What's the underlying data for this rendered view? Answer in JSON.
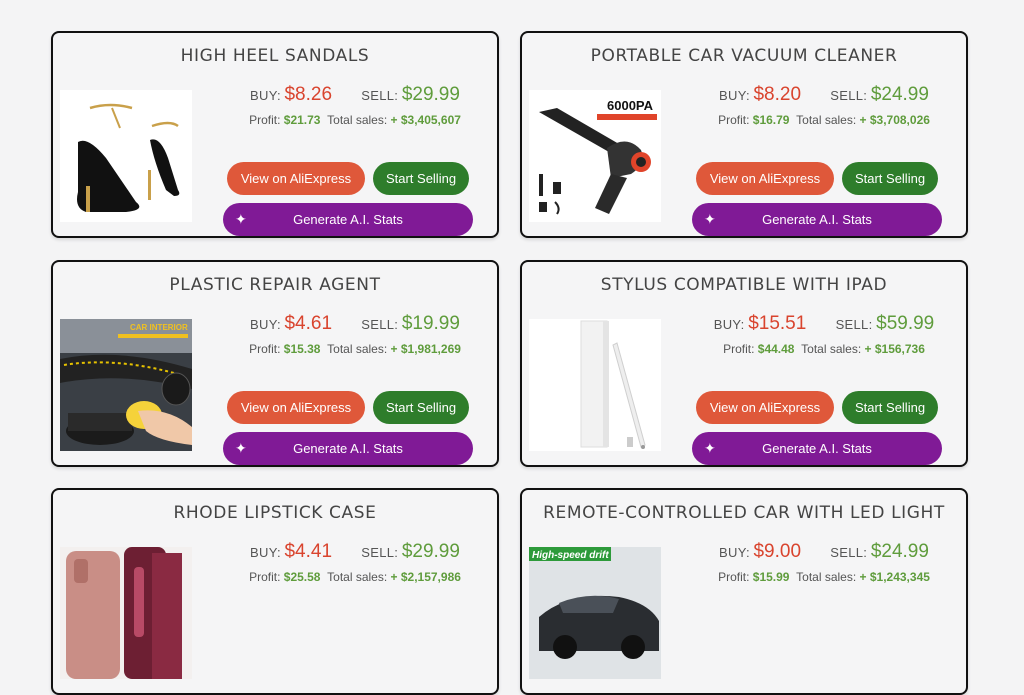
{
  "labels": {
    "buy": "BUY:",
    "sell": "SELL:",
    "profit": "Profit:",
    "total_sales": "Total sales:",
    "view_btn": "View on AliExpress",
    "start_btn": "Start Selling",
    "ai_btn": "Generate A.I. Stats"
  },
  "products": [
    {
      "title": "HIGH HEEL SANDALS",
      "buy": "$8.26",
      "sell": "$29.99",
      "profit": "$21.73",
      "total_sales": "+ $3,405,607",
      "image": "sandal"
    },
    {
      "title": "PORTABLE CAR VACUUM CLEANER",
      "buy": "$8.20",
      "sell": "$24.99",
      "profit": "$16.79",
      "total_sales": "+ $3,708,026",
      "image": "vacuum",
      "image_text": "6000PA"
    },
    {
      "title": "PLASTIC REPAIR AGENT",
      "buy": "$4.61",
      "sell": "$19.99",
      "profit": "$15.38",
      "total_sales": "+ $1,981,269",
      "image": "repair",
      "image_text": "CAR INTERIOR"
    },
    {
      "title": "STYLUS COMPATIBLE WITH IPAD",
      "buy": "$15.51",
      "sell": "$59.99",
      "profit": "$44.48",
      "total_sales": "+ $156,736",
      "image": "stylus"
    },
    {
      "title": "RHODE LIPSTICK CASE",
      "buy": "$4.41",
      "sell": "$29.99",
      "profit": "$25.58",
      "total_sales": "+ $2,157,986",
      "image": "lipstick"
    },
    {
      "title": "REMOTE-CONTROLLED CAR WITH LED LIGHT",
      "buy": "$9.00",
      "sell": "$24.99",
      "profit": "$15.99",
      "total_sales": "+ $1,243,345",
      "image": "rc-car",
      "image_text": "High-speed drift"
    }
  ],
  "colors": {
    "buy": "#d9442e",
    "sell": "#5f9c3c",
    "view_btn": "#df583a",
    "start_btn": "#2e7d2b",
    "ai_btn": "#801a96"
  },
  "icons": {
    "ai_btn": "sparkle-icon"
  }
}
